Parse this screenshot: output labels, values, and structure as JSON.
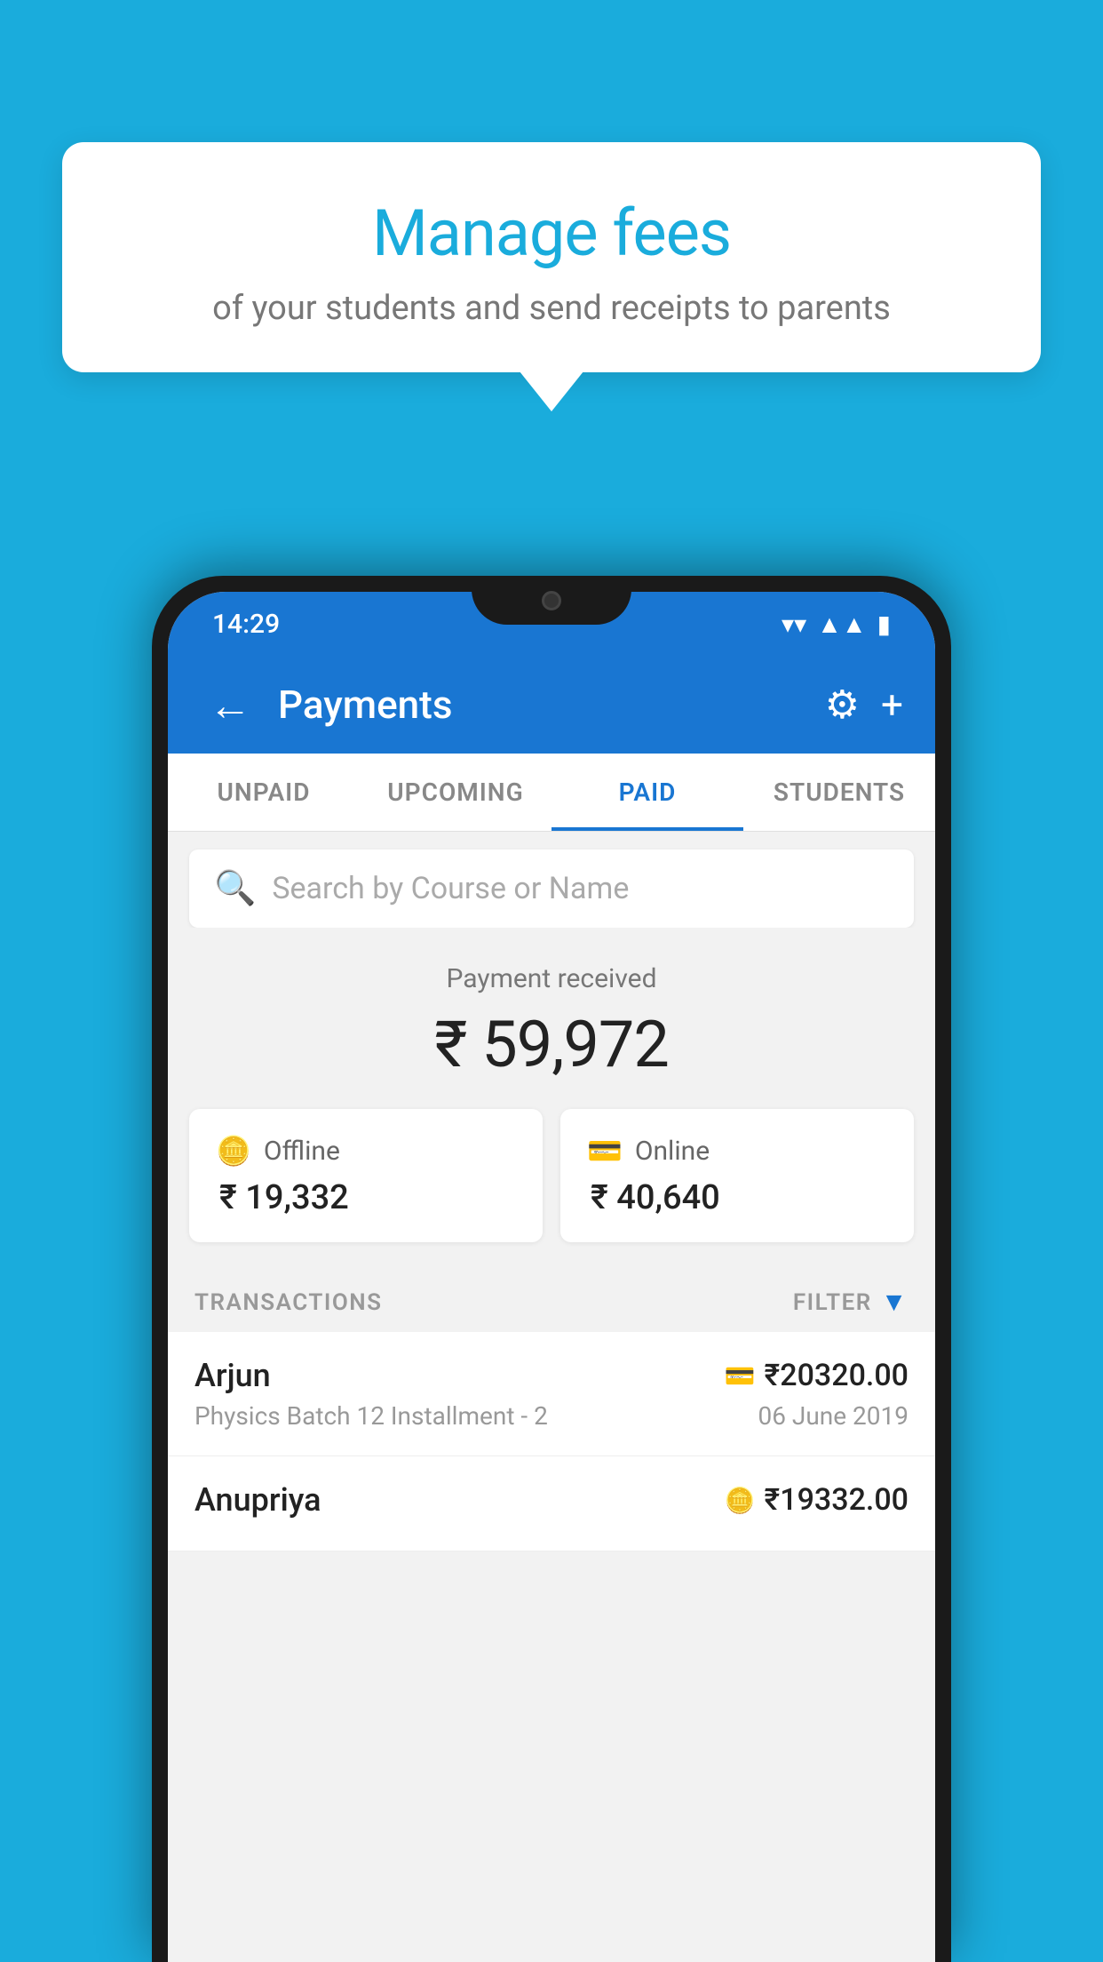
{
  "page": {
    "background_color": "#1AACDC"
  },
  "tooltip": {
    "title": "Manage fees",
    "subtitle": "of your students and send receipts to parents"
  },
  "status_bar": {
    "time": "14:29",
    "wifi_icon": "▼",
    "signal_icon": "▲",
    "battery_icon": "▮"
  },
  "app_bar": {
    "back_icon": "←",
    "title": "Payments",
    "settings_icon": "⚙",
    "add_icon": "+"
  },
  "tabs": [
    {
      "id": "unpaid",
      "label": "UNPAID",
      "active": false
    },
    {
      "id": "upcoming",
      "label": "UPCOMING",
      "active": false
    },
    {
      "id": "paid",
      "label": "PAID",
      "active": true
    },
    {
      "id": "students",
      "label": "STUDENTS",
      "active": false
    }
  ],
  "search": {
    "placeholder": "Search by Course or Name"
  },
  "payment_summary": {
    "label": "Payment received",
    "amount": "₹ 59,972",
    "offline": {
      "label": "Offline",
      "amount": "₹ 19,332"
    },
    "online": {
      "label": "Online",
      "amount": "₹ 40,640"
    }
  },
  "transactions_section": {
    "header_label": "TRANSACTIONS",
    "filter_label": "FILTER"
  },
  "transactions": [
    {
      "name": "Arjun",
      "amount": "₹20320.00",
      "detail": "Physics Batch 12 Installment - 2",
      "date": "06 June 2019",
      "payment_type": "card"
    },
    {
      "name": "Anupriya",
      "amount": "₹19332.00",
      "detail": "",
      "date": "",
      "payment_type": "offline"
    }
  ]
}
